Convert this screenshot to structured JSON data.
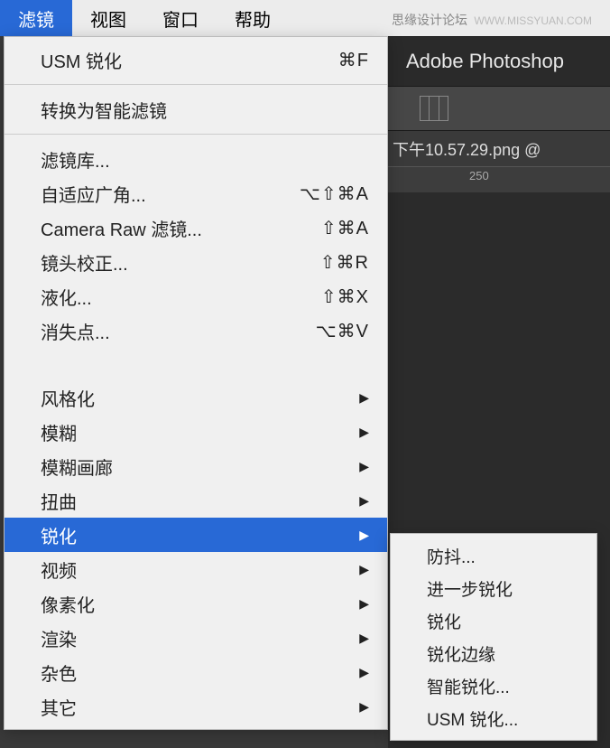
{
  "watermark": {
    "main": "思缘设计论坛",
    "url": "WWW.MISSYUAN.COM"
  },
  "menubar": {
    "items": [
      {
        "label": "滤镜",
        "active": true
      },
      {
        "label": "视图",
        "active": false
      },
      {
        "label": "窗口",
        "active": false
      },
      {
        "label": "帮助",
        "active": false
      }
    ]
  },
  "ps": {
    "app_name": "Adobe Photoshop",
    "doc_tab": "下午10.57.29.png @",
    "ruler_value": "250"
  },
  "dropdown": {
    "section1": [
      {
        "label": "USM 锐化",
        "shortcut": "⌘F"
      }
    ],
    "section2": [
      {
        "label": "转换为智能滤镜"
      }
    ],
    "section3": [
      {
        "label": "滤镜库..."
      },
      {
        "label": "自适应广角...",
        "shortcut": "⌥⇧⌘A"
      },
      {
        "label": "Camera Raw 滤镜...",
        "shortcut": "⇧⌘A"
      },
      {
        "label": "镜头校正...",
        "shortcut": "⇧⌘R"
      },
      {
        "label": "液化...",
        "shortcut": "⇧⌘X"
      },
      {
        "label": "消失点...",
        "shortcut": "⌥⌘V"
      }
    ],
    "section4": [
      {
        "label": "风格化",
        "submenu": true
      },
      {
        "label": "模糊",
        "submenu": true
      },
      {
        "label": "模糊画廊",
        "submenu": true
      },
      {
        "label": "扭曲",
        "submenu": true
      },
      {
        "label": "锐化",
        "submenu": true,
        "highlighted": true
      },
      {
        "label": "视频",
        "submenu": true
      },
      {
        "label": "像素化",
        "submenu": true
      },
      {
        "label": "渲染",
        "submenu": true
      },
      {
        "label": "杂色",
        "submenu": true
      },
      {
        "label": "其它",
        "submenu": true
      }
    ]
  },
  "submenu": {
    "items": [
      {
        "label": "防抖..."
      },
      {
        "label": "进一步锐化"
      },
      {
        "label": "锐化"
      },
      {
        "label": "锐化边缘"
      },
      {
        "label": "智能锐化..."
      },
      {
        "label": "USM 锐化..."
      }
    ]
  }
}
